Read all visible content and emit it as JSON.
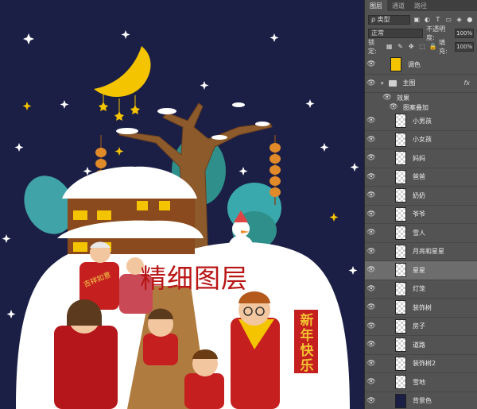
{
  "canvas": {
    "overlay_title": "精细图层",
    "greeting_banner": "新年快乐",
    "badge_text": "吉祥如意"
  },
  "panel": {
    "tabs": [
      {
        "label": "图层"
      },
      {
        "label": "通道"
      },
      {
        "label": "路径"
      }
    ],
    "filter_select": "ρ 类型",
    "blend_mode": "正常",
    "opacity_label": "不透明度:",
    "opacity_value": "100%",
    "lock_label": "锁定:",
    "fill_label": "填充:",
    "fill_value": "100%",
    "layers": [
      {
        "name": "调色",
        "thumb": "solid"
      },
      {
        "name": "主图",
        "type": "group",
        "fx": "fx"
      },
      {
        "name": "效果",
        "type": "effect"
      },
      {
        "name": "图案叠加",
        "type": "effect-item"
      },
      {
        "name": "小男孩"
      },
      {
        "name": "小女孩"
      },
      {
        "name": "妈妈"
      },
      {
        "name": "爸爸"
      },
      {
        "name": "奶奶"
      },
      {
        "name": "爷爷"
      },
      {
        "name": "雪人"
      },
      {
        "name": "月亮和星星"
      },
      {
        "name": "星星",
        "selected": true
      },
      {
        "name": "灯笼"
      },
      {
        "name": "装饰树"
      },
      {
        "name": "房子"
      },
      {
        "name": "道路"
      },
      {
        "name": "装饰树2"
      },
      {
        "name": "雪地"
      },
      {
        "name": "背景色",
        "thumb": "navy"
      }
    ]
  },
  "colors": {
    "background": "#1b1f45",
    "panel": "#535353",
    "accent_red": "#b91616",
    "moon_yellow": "#f5c400"
  }
}
